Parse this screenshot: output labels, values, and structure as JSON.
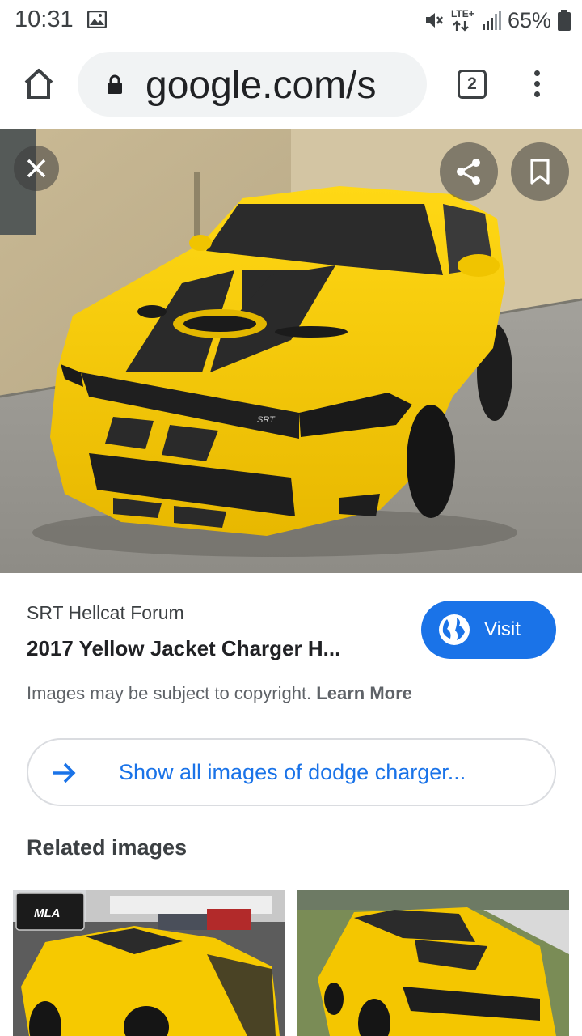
{
  "status_bar": {
    "time": "10:31",
    "network": "LTE+",
    "battery": "65%"
  },
  "browser": {
    "url": "google.com/s",
    "tab_count": "2"
  },
  "image_viewer": {
    "source": "SRT Hellcat Forum",
    "title": "2017 Yellow Jacket Charger H...",
    "visit_label": "Visit",
    "copyright_text": "Images may be subject to copyright.",
    "learn_more": "Learn More",
    "show_all_label": "Show all images of dodge charger...",
    "related_heading": "Related images",
    "thumb_1_logo": "MLA"
  },
  "colors": {
    "accent": "#1a73e8",
    "car_yellow": "#f5c800",
    "stripe": "#2a2a2a"
  }
}
